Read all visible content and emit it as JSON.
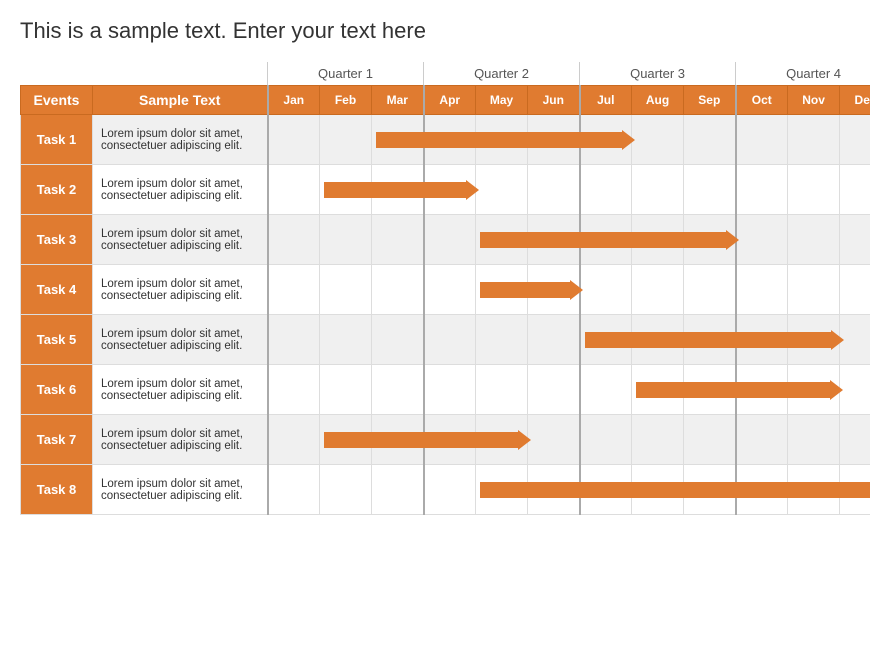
{
  "title": "This is a sample text. Enter your text here",
  "header": {
    "events_label": "Events",
    "desc_label": "Sample Text"
  },
  "quarters": [
    {
      "label": "Quarter 1",
      "span": 3
    },
    {
      "label": "Quarter 2",
      "span": 3
    },
    {
      "label": "Quarter 3",
      "span": 3
    },
    {
      "label": "Quarter 4",
      "span": 3
    }
  ],
  "months": [
    "Jan",
    "Feb",
    "Mar",
    "Apr",
    "May",
    "Jun",
    "Jul",
    "Aug",
    "Sep",
    "Oct",
    "Nov",
    "Dec"
  ],
  "tasks": [
    {
      "id": "Task 1",
      "desc1": "Lorem ipsum dolor sit amet,",
      "desc2": "consectetuer adipiscing elit.",
      "bar_start_col": 2,
      "bar_span": 5
    },
    {
      "id": "Task 2",
      "desc1": "Lorem ipsum dolor sit amet,",
      "desc2": "consectetuer adipiscing elit.",
      "bar_start_col": 1,
      "bar_span": 3
    },
    {
      "id": "Task 3",
      "desc1": "Lorem ipsum dolor sit amet,",
      "desc2": "consectetuer adipiscing elit.",
      "bar_start_col": 4,
      "bar_span": 5
    },
    {
      "id": "Task 4",
      "desc1": "Lorem ipsum dolor sit amet,",
      "desc2": "consectetuer adipiscing elit.",
      "bar_start_col": 4,
      "bar_span": 2
    },
    {
      "id": "Task 5",
      "desc1": "Lorem ipsum dolor sit amet,",
      "desc2": "consectetuer adipiscing elit.",
      "bar_start_col": 6,
      "bar_span": 5
    },
    {
      "id": "Task 6",
      "desc1": "Lorem ipsum dolor sit amet,",
      "desc2": "consectetuer adipiscing elit.",
      "bar_start_col": 7,
      "bar_span": 4
    },
    {
      "id": "Task 7",
      "desc1": "Lorem ipsum dolor sit amet,",
      "desc2": "consectetuer adipiscing elit.",
      "bar_start_col": 1,
      "bar_span": 4
    },
    {
      "id": "Task 8",
      "desc1": "Lorem ipsum dolor sit amet,",
      "desc2": "consectetuer adipiscing elit.",
      "bar_start_col": 4,
      "bar_span": 9
    }
  ],
  "colors": {
    "orange": "#e07b30",
    "orange_dark": "#c96a20",
    "row_even": "#f0f0f0",
    "row_odd": "#ffffff"
  }
}
